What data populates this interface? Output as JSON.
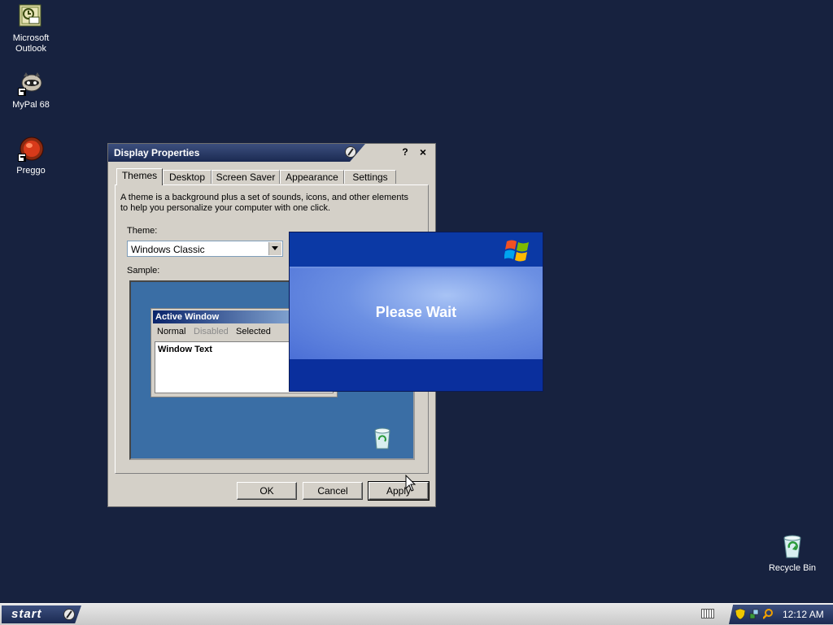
{
  "desktop": {
    "icons": [
      {
        "label": "Microsoft\nOutlook"
      },
      {
        "label": "MyPal 68"
      },
      {
        "label": "Preggo"
      },
      {
        "label": "Recycle Bin"
      }
    ]
  },
  "display_properties": {
    "title": "Display Properties",
    "help_glyph": "?",
    "close_glyph": "×",
    "tabs": [
      {
        "label": "Themes"
      },
      {
        "label": "Desktop"
      },
      {
        "label": "Screen Saver"
      },
      {
        "label": "Appearance"
      },
      {
        "label": "Settings"
      }
    ],
    "description": "A theme is a background plus a set of sounds, icons, and other elements to help you personalize your computer with one click.",
    "theme_label": "Theme:",
    "theme_value": "Windows Classic",
    "sample_label": "Sample:",
    "sample": {
      "window_title": "Active Window",
      "menu": [
        "Normal",
        "Disabled",
        "Selected"
      ],
      "window_text": "Window Text"
    },
    "buttons": {
      "ok": "OK",
      "cancel": "Cancel",
      "apply": "Apply"
    }
  },
  "please_wait": {
    "message": "Please Wait"
  },
  "taskbar": {
    "start_label": "start",
    "clock": "12:12 AM"
  },
  "colors": {
    "desktop": "#17223f",
    "titlebar": "#1b2a52",
    "sample_bg": "#3a6ea5",
    "wait_blue": "#003399"
  }
}
